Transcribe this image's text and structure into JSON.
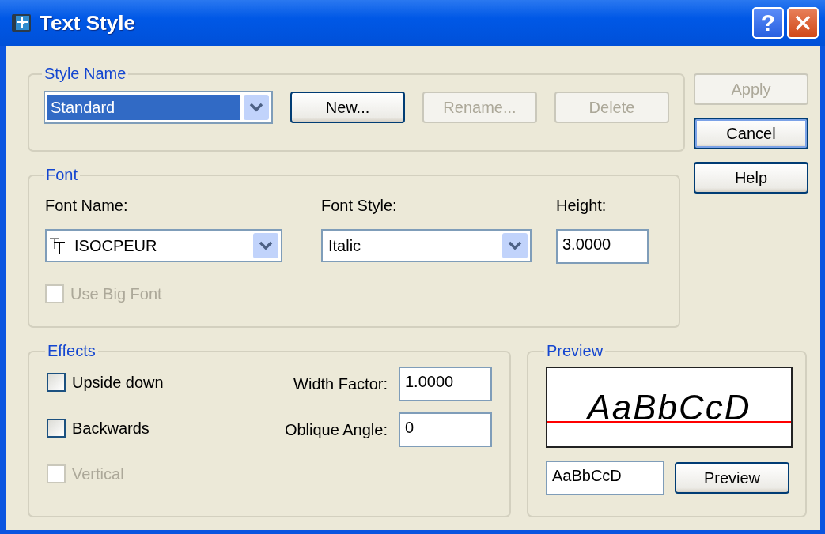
{
  "window": {
    "title": "Text Style",
    "help_button": "?"
  },
  "style_name": {
    "legend": "Style Name",
    "dropdown": {
      "value": "Standard",
      "highlighted": true
    },
    "buttons": [
      {
        "label": "New...",
        "disabled": false
      },
      {
        "label": "Rename...",
        "disabled": true
      },
      {
        "label": "Delete",
        "disabled": true
      }
    ]
  },
  "side_buttons": [
    {
      "label": "Apply",
      "disabled": true,
      "focused": false
    },
    {
      "label": "Cancel",
      "disabled": false,
      "focused": true
    },
    {
      "label": "Help",
      "disabled": false,
      "focused": false
    }
  ],
  "font": {
    "legend": "Font",
    "font_name": {
      "label": "Font Name:",
      "value": "ISOCPEUR"
    },
    "font_style": {
      "label": "Font Style:",
      "value": "Italic"
    },
    "height": {
      "label": "Height:",
      "value": "3.0000"
    },
    "use_big_font": {
      "label": "Use Big Font",
      "checked": false,
      "disabled": true
    }
  },
  "effects": {
    "legend": "Effects",
    "checkboxes": [
      {
        "label": "Upside down",
        "checked": false,
        "disabled": false
      },
      {
        "label": "Backwards",
        "checked": false,
        "disabled": false
      },
      {
        "label": "Vertical",
        "checked": false,
        "disabled": true
      }
    ],
    "fields": [
      {
        "label": "Width Factor:",
        "value": "1.0000"
      },
      {
        "label": "Oblique Angle:",
        "value": "0"
      }
    ]
  },
  "preview": {
    "legend": "Preview",
    "sample": "AaBbCcD",
    "input": "AaBbCcD",
    "button": "Preview"
  }
}
